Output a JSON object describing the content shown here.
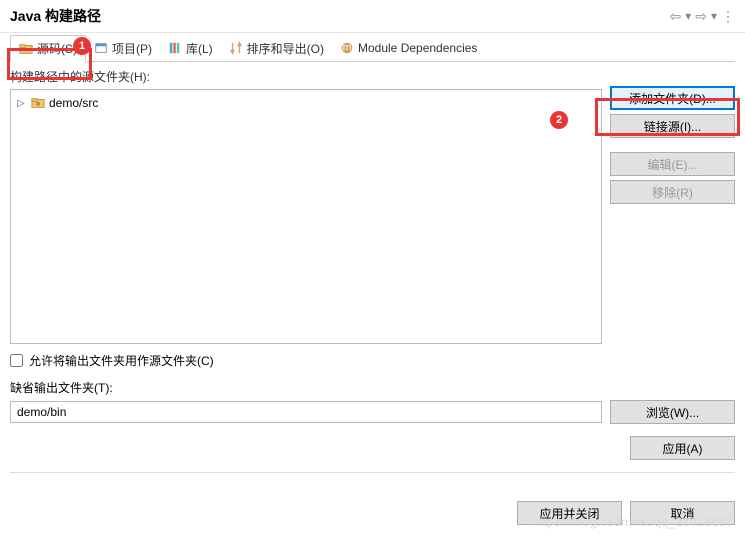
{
  "header": {
    "title": "Java 构建路径"
  },
  "tabs": {
    "source": "源码(S)",
    "projects": "项目(P)",
    "libraries": "库(L)",
    "order": "排序和导出(O)",
    "modules": "Module Dependencies"
  },
  "source": {
    "label": "构建路径中的源文件夹(H):",
    "tree_item": "demo/src",
    "checkbox_label": "允许将输出文件夹用作源文件夹(C)",
    "output_label": "缺省输出文件夹(T):",
    "output_value": "demo/bin"
  },
  "buttons": {
    "add_folder": "添加文件夹(D)...",
    "link_source": "链接源(I)...",
    "edit": "编辑(E)...",
    "remove": "移除(R)",
    "browse": "浏览(W)...",
    "apply": "应用(A)",
    "apply_close": "应用并关闭",
    "cancel": "取消"
  },
  "watermark": "https://blog.csdn.net/qq_28018687"
}
